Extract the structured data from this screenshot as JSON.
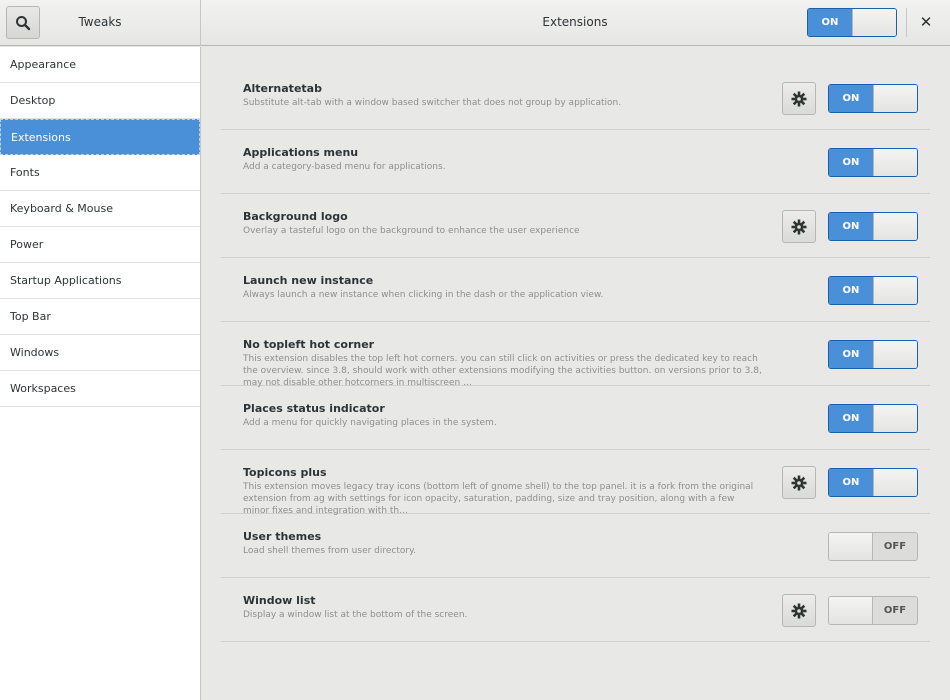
{
  "header": {
    "app_title": "Tweaks",
    "page_title": "Extensions",
    "master_switch": "ON",
    "close_label": "✕"
  },
  "sidebar": {
    "items": [
      {
        "label": "Appearance"
      },
      {
        "label": "Desktop"
      },
      {
        "label": "Extensions"
      },
      {
        "label": "Fonts"
      },
      {
        "label": "Keyboard & Mouse"
      },
      {
        "label": "Power"
      },
      {
        "label": "Startup Applications"
      },
      {
        "label": "Top Bar"
      },
      {
        "label": "Windows"
      },
      {
        "label": "Workspaces"
      }
    ],
    "selected": "Extensions"
  },
  "extensions": [
    {
      "name": "Alternatetab",
      "desc": "Substitute alt-tab with a window based switcher that does not group by application.",
      "has_settings": true,
      "state": "ON"
    },
    {
      "name": "Applications menu",
      "desc": "Add a category-based menu for applications.",
      "has_settings": false,
      "state": "ON"
    },
    {
      "name": "Background logo",
      "desc": "Overlay a tasteful logo on the background to enhance the user experience",
      "has_settings": true,
      "state": "ON"
    },
    {
      "name": "Launch new instance",
      "desc": "Always launch a new instance when clicking in the dash or the application view.",
      "has_settings": false,
      "state": "ON"
    },
    {
      "name": "No topleft hot corner",
      "desc": "This extension disables the top left hot corners. you can still click on activities or press the dedicated key to reach the overview. since 3.8, should work with other extensions modifying the activities button. on versions prior to 3.8, may not disable other hotcorners in multiscreen …",
      "has_settings": false,
      "state": "ON"
    },
    {
      "name": "Places status indicator",
      "desc": "Add a menu for quickly navigating places in the system.",
      "has_settings": false,
      "state": "ON"
    },
    {
      "name": "Topicons plus",
      "desc": "This extension moves legacy tray icons (bottom left of gnome shell) to the top panel. it is a fork from the original extension from ag  with settings for icon opacity, saturation, padding, size and tray position, along with a few minor fixes and integration with th…",
      "has_settings": true,
      "state": "ON"
    },
    {
      "name": "User themes",
      "desc": "Load shell themes from user directory.",
      "has_settings": false,
      "state": "OFF"
    },
    {
      "name": "Window list",
      "desc": "Display a window list at the bottom of the screen.",
      "has_settings": true,
      "state": "OFF"
    }
  ],
  "colors": {
    "accent": "#4a90d9",
    "background": "#e8e8e7"
  }
}
